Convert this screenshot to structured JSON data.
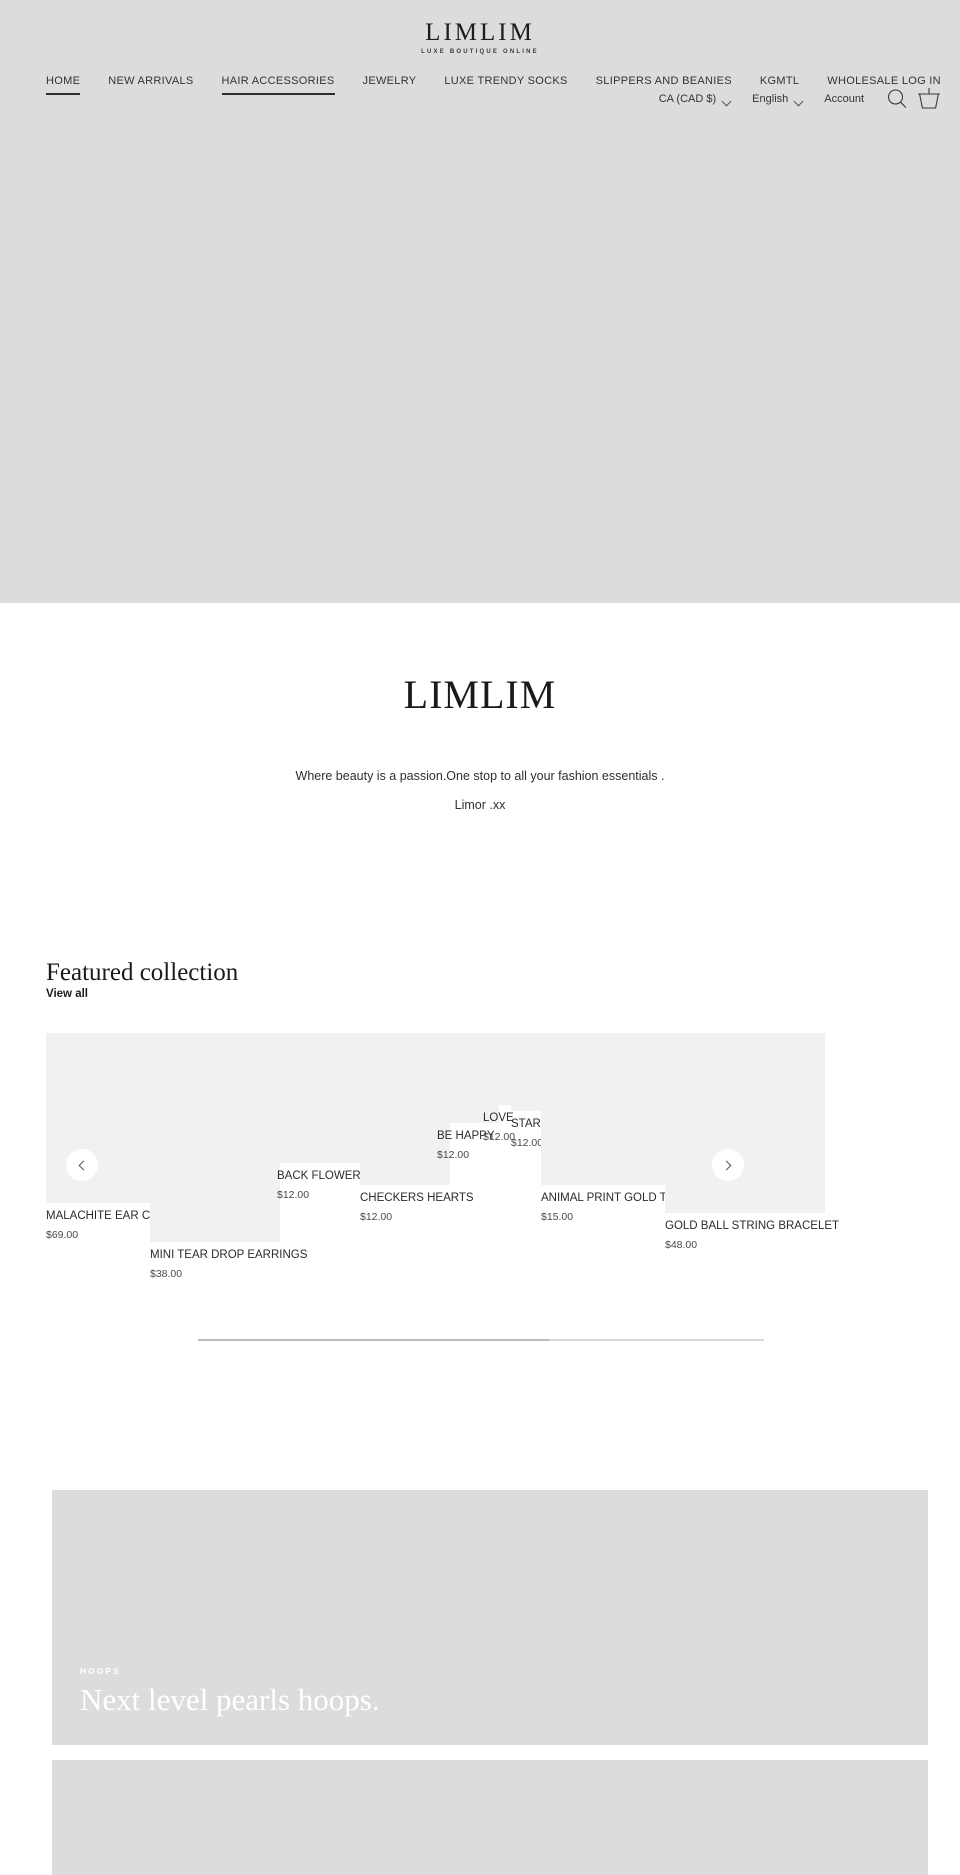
{
  "header": {
    "logo": {
      "word": "LIMLIM",
      "tagline": "LUXE BOUTIQUE ONLINE"
    },
    "nav": [
      {
        "label": "HOME",
        "active": true
      },
      {
        "label": "NEW ARRIVALS",
        "active": false
      },
      {
        "label": "HAIR ACCESSORIES",
        "active": true
      },
      {
        "label": "JEWELRY",
        "active": false
      },
      {
        "label": "LUXE TRENDY SOCKS",
        "active": false
      },
      {
        "label": "SLIPPERS AND BEANIES",
        "active": false
      },
      {
        "label": "KGMTL",
        "active": false
      },
      {
        "label": "WHOLESALE LOG IN",
        "active": false
      }
    ],
    "currency": "CA (CAD $)",
    "language": "English",
    "account": "Account",
    "search_icon": "search-icon",
    "cart_icon": "cart-icon"
  },
  "intro": {
    "title": "LIMLIM",
    "line1": "Where beauty is a passion.One stop to all your fashion essentials .",
    "line2": "Limor .xx"
  },
  "featured": {
    "title": "Featured collection",
    "view_all": "View all",
    "prev_label": "Previous",
    "next_label": "Next",
    "progress_percent": 62,
    "products": [
      {
        "title": "MALACHITE EAR CUFF",
        "price": "$69.00"
      },
      {
        "title": "MINI TEAR DROP EARRINGS",
        "price": "$38.00"
      },
      {
        "title": "BACK FLOWER",
        "price": "$12.00"
      },
      {
        "title": "CHECKERS HEARTS",
        "price": "$12.00"
      },
      {
        "title": "BE HAPPY",
        "price": "$12.00"
      },
      {
        "title": "LOVE",
        "price": "$12.00"
      },
      {
        "title": "STARS",
        "price": "$12.00"
      },
      {
        "title": "ANIMAL PRINT GOLD TRIM",
        "price": "$15.00"
      },
      {
        "title": "GOLD BALL STRING BRACELET",
        "price": "$48.00"
      }
    ]
  },
  "promos": [
    {
      "eyebrow": "HOOPS",
      "title": "Next level pearls hoops."
    },
    {
      "eyebrow": "",
      "title": ""
    }
  ],
  "colors": {
    "header_bg": "#dcdcdc",
    "card_bg": "#f1f1f1",
    "text": "#2b2b2b"
  }
}
